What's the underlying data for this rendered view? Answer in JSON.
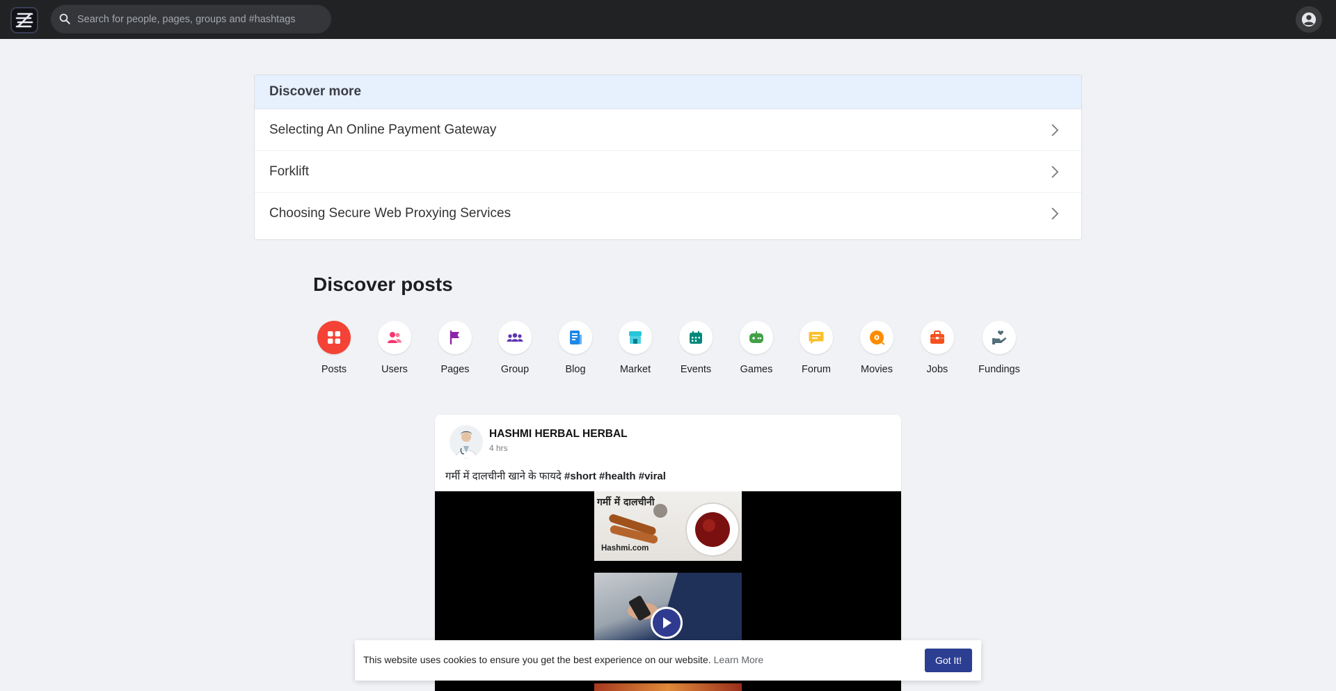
{
  "topbar": {
    "search_placeholder": "Search for people, pages, groups and #hashtags"
  },
  "discover_more": {
    "title": "Discover more",
    "items": [
      {
        "label": "Selecting An Online Payment Gateway"
      },
      {
        "label": "Forklift"
      },
      {
        "label": "Choosing Secure Web Proxying Services"
      }
    ]
  },
  "discover_posts": {
    "title": "Discover posts",
    "categories": [
      {
        "label": "Posts",
        "icon": "grid-icon",
        "color": "#ffffff",
        "active": true
      },
      {
        "label": "Users",
        "icon": "users-icon",
        "color": "#f5356e"
      },
      {
        "label": "Pages",
        "icon": "flag-icon",
        "color": "#8e24aa"
      },
      {
        "label": "Group",
        "icon": "group-icon",
        "color": "#5e35b1"
      },
      {
        "label": "Blog",
        "icon": "blog-icon",
        "color": "#1e88e5"
      },
      {
        "label": "Market",
        "icon": "store-icon",
        "color": "#26c6da"
      },
      {
        "label": "Events",
        "icon": "calendar-icon",
        "color": "#00897b"
      },
      {
        "label": "Games",
        "icon": "gamepad-icon",
        "color": "#43a047"
      },
      {
        "label": "Forum",
        "icon": "chat-icon",
        "color": "#fbc02d"
      },
      {
        "label": "Movies",
        "icon": "film-icon",
        "color": "#fb8c00"
      },
      {
        "label": "Jobs",
        "icon": "briefcase-icon",
        "color": "#f4511e"
      },
      {
        "label": "Fundings",
        "icon": "hand-heart-icon",
        "color": "#546e7a"
      }
    ]
  },
  "post": {
    "author": "HASHMI HERBAL HERBAL",
    "time": "4 hrs",
    "text": "गर्मी में दालचीनी खाने के फायदे",
    "hashtags": "#short #health #viral",
    "video_frame_title": "गर्मी में दालचीनी",
    "video_frame_logo": "Hashmi.com"
  },
  "cookie": {
    "text": "This website uses cookies to ensure you get the best experience on our website.",
    "link": "Learn More",
    "button": "Got It!"
  },
  "colors": {
    "topbar": "#202224",
    "active_category": "#f44336",
    "cookie_button": "#2c3e91"
  }
}
